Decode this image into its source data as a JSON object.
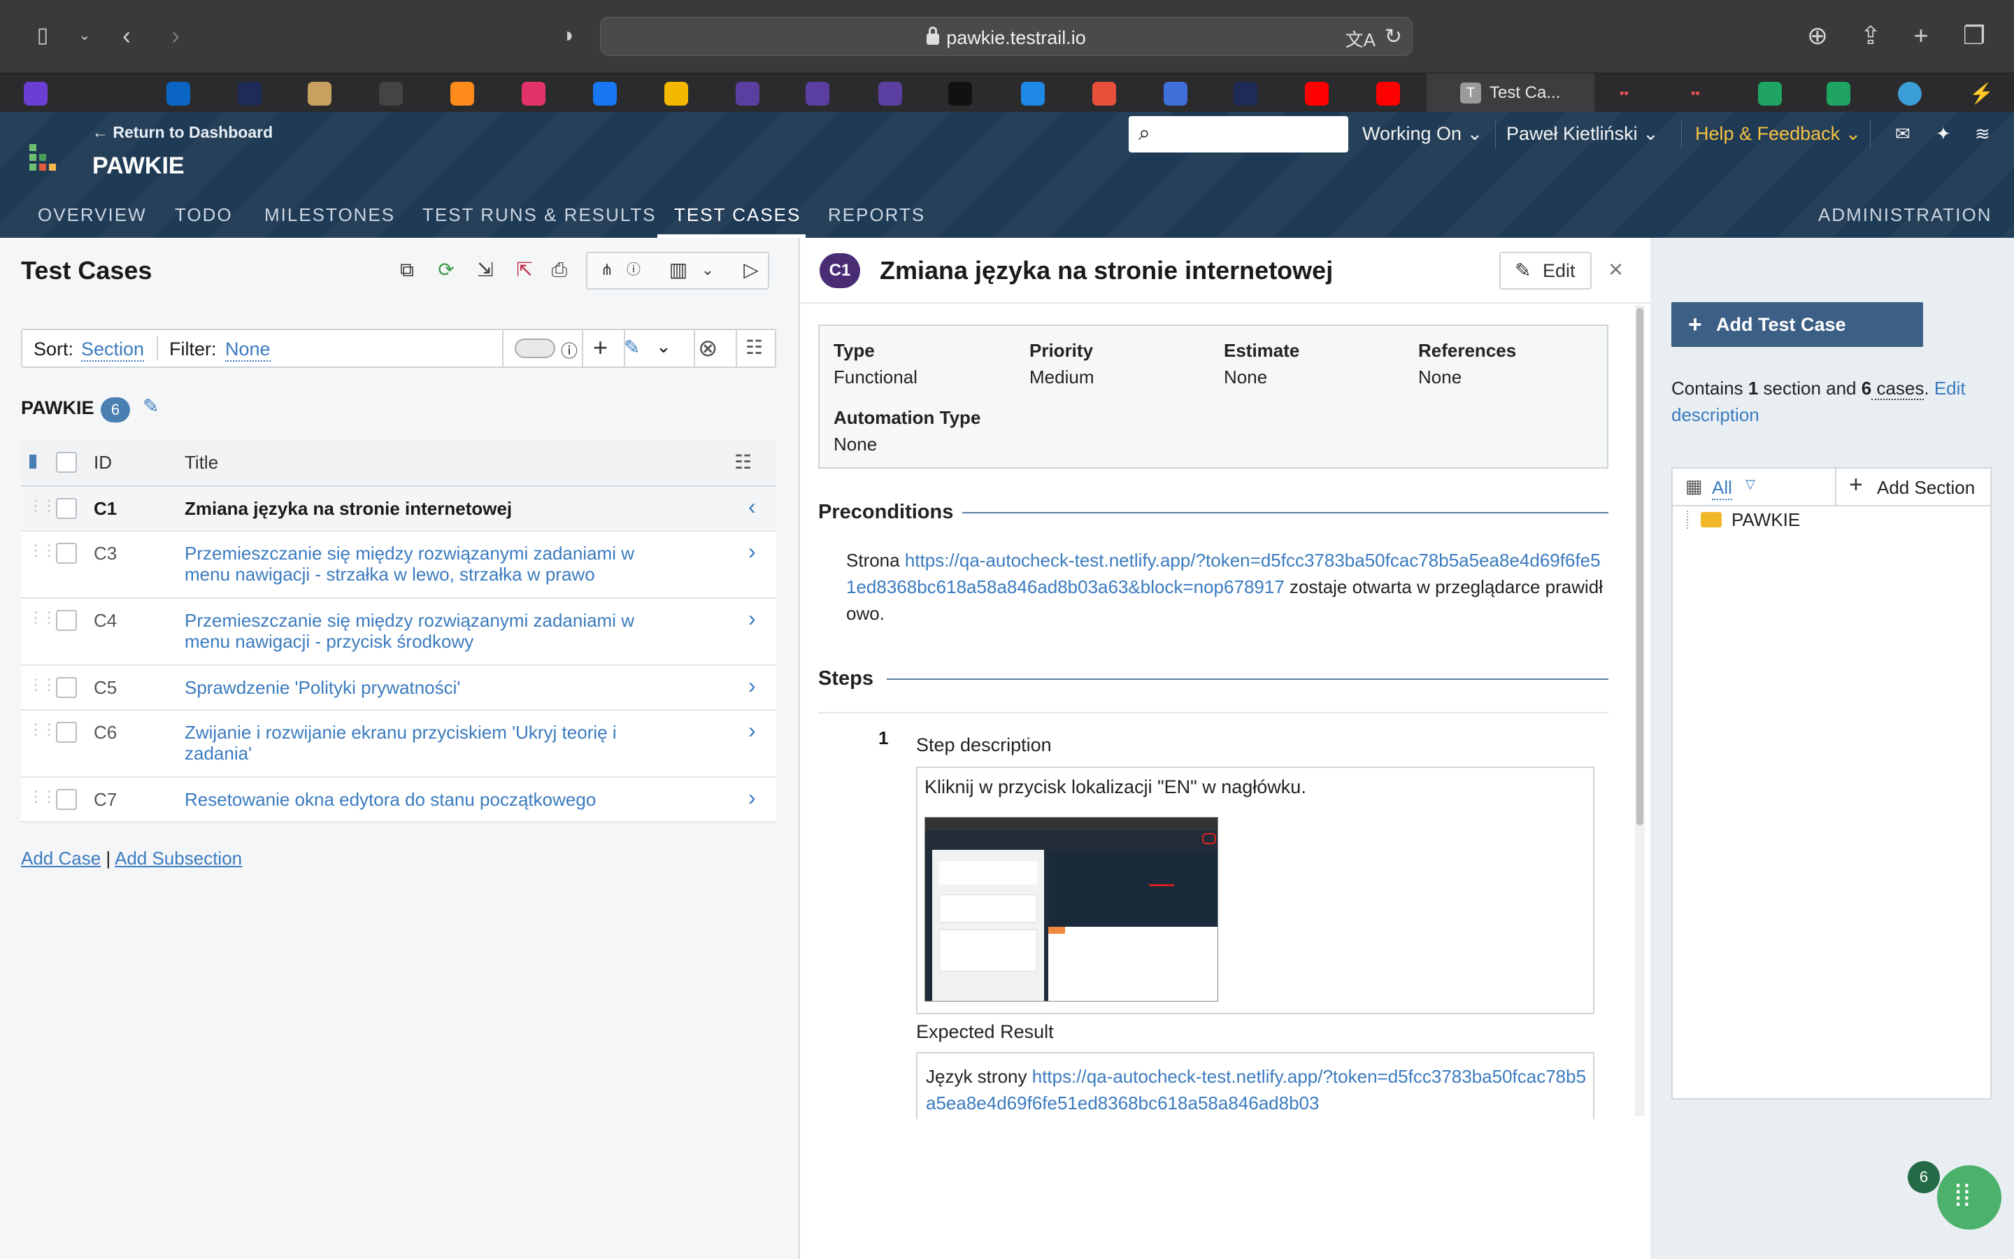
{
  "browser": {
    "url": "pawkie.testrail.io",
    "active_tab_label": "Test Ca...",
    "bookmark_colors": [
      "#6b3fd4",
      "#2b2b2d",
      "#0a66c2",
      "#1d2b56",
      "#c8a060",
      "#444",
      "#ff8c1a",
      "#e23468",
      "#1877f2",
      "#f5b800",
      "#5a3fa0",
      "#5a3fa0",
      "#5a3fa0",
      "#111",
      "#1e88e5",
      "#e8503a",
      "#3f6fd8",
      "#1d2b56",
      "#ff0000",
      "#ff0000"
    ]
  },
  "header": {
    "return_label": "← Return to Dashboard",
    "project": "PAWKIE",
    "menus": [
      "Working On",
      "Paweł Kietliński",
      "Help & Feedback"
    ],
    "help_color": "#f5c242",
    "nav": [
      "OVERVIEW",
      "TODO",
      "MILESTONES",
      "TEST RUNS & RESULTS",
      "TEST CASES",
      "REPORTS"
    ],
    "admin": "ADMINISTRATION"
  },
  "left": {
    "title": "Test Cases",
    "sort_label": "Sort:",
    "sort_value": "Section",
    "filter_label": "Filter:",
    "filter_value": "None",
    "section_name": "PAWKIE",
    "section_count": "6",
    "col_id": "ID",
    "col_title": "Title",
    "rows": [
      {
        "id": "C1",
        "title": "Zmiana języka na stronie internetowej"
      },
      {
        "id": "C3",
        "title": "Przemieszczanie się między rozwiązanymi zadaniami w menu nawigacji - strzałka w lewo, strzałka w prawo"
      },
      {
        "id": "C4",
        "title": "Przemieszczanie się między rozwiązanymi zadaniami w menu nawigacji - przycisk środkowy"
      },
      {
        "id": "C5",
        "title": "Sprawdzenie 'Polityki prywatności'"
      },
      {
        "id": "C6",
        "title": "Zwijanie i rozwijanie ekranu przyciskiem 'Ukryj teorię i zadania'"
      },
      {
        "id": "C7",
        "title": "Resetowanie okna edytora do stanu początkowego"
      }
    ],
    "add_case": "Add Case",
    "sep": "|",
    "add_subsection": "Add Subsection"
  },
  "case": {
    "badge": "C1",
    "title": "Zmiana języka na stronie internetowej",
    "edit": "Edit",
    "type_label": "Type",
    "type_value": "Functional",
    "priority_label": "Priority",
    "priority_value": "Medium",
    "estimate_label": "Estimate",
    "estimate_value": "None",
    "references_label": "References",
    "references_value": "None",
    "automation_label": "Automation Type",
    "automation_value": "None",
    "preconditions_head": "Preconditions",
    "pre_before": "Strona ",
    "pre_link": "https://qa-autocheck-test.netlify.app/?token=d5fcc3783ba50fcac78b5a5ea8e4d69f6fe51ed8368bc618a58a846ad8b03a63&block=nop678917",
    "pre_after": " zostaje otwarta w przeglądarce prawidłowo.",
    "steps_head": "Steps",
    "step_num": "1",
    "step_desc_label": "Step description",
    "step_text": "Kliknij w przycisk lokalizacji \"EN\" w nagłówku.",
    "expected_label": "Expected Result",
    "exp_before": "Język strony ",
    "exp_link": "https://qa-autocheck-test.netlify.app/?token=d5fcc3783ba50fcac78b5a5ea8e4d69f6fe51ed8368bc618a58a846ad8b03"
  },
  "right": {
    "add_button": "Add Test Case",
    "c1": "Contains ",
    "c2": "1",
    "c3": " section and ",
    "c4": "6",
    "c5": " cases",
    "c6": ". ",
    "edit_desc": "Edit description",
    "tree_all": "All",
    "add_section": "Add Section",
    "folder": "PAWKIE"
  },
  "fab_badge": "6"
}
